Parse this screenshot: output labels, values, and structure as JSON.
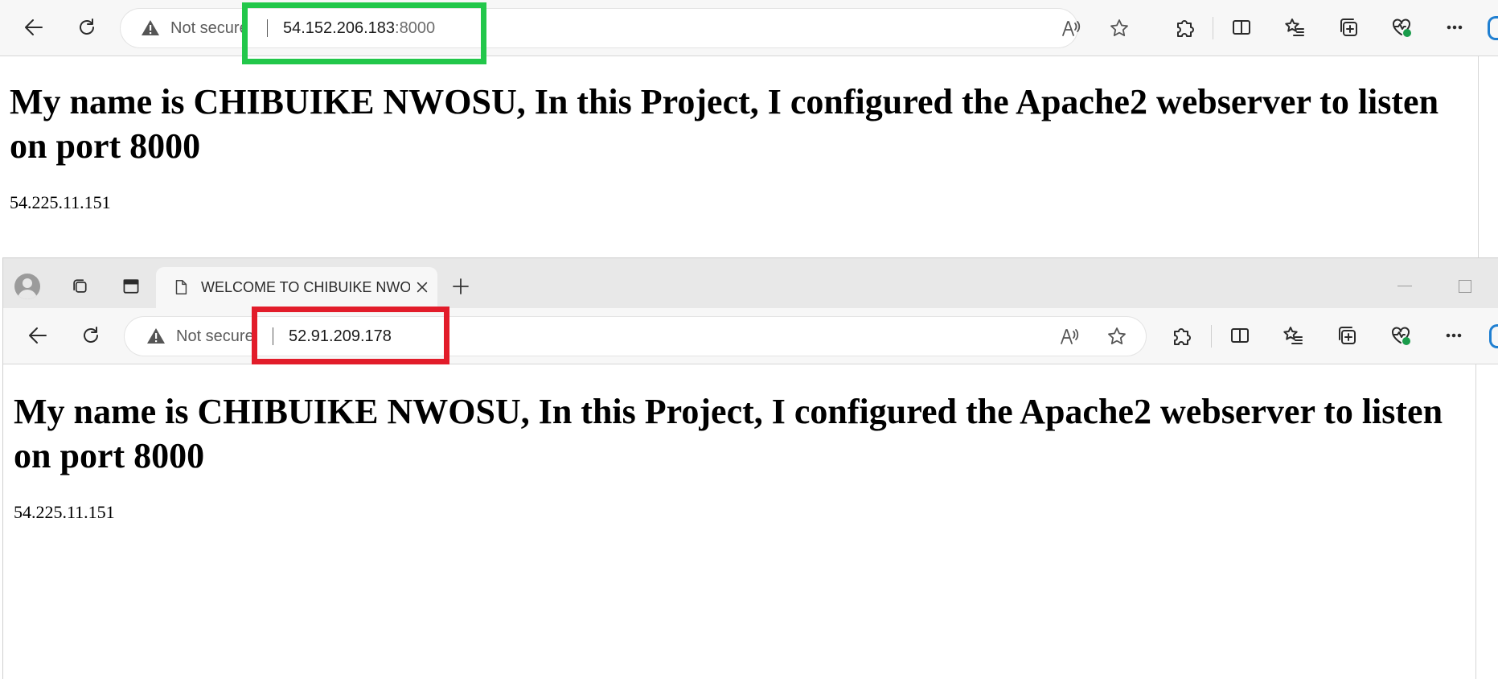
{
  "window_top": {
    "toolbar": {
      "back": "back-arrow",
      "refresh": "refresh",
      "security_label": "Not secure",
      "url_host": "54.152.206.183",
      "url_port": ":8000"
    },
    "page": {
      "heading": "My name is CHIBUIKE NWOSU, In this Project, I configured the Apache2 webserver to listen on port 8000",
      "ip_text": "54.225.11.151"
    },
    "highlight_color": "#22c74a"
  },
  "window_bottom": {
    "tab": {
      "title": "WELCOME TO CHIBUIKE NWOSU"
    },
    "toolbar": {
      "security_label": "Not secure",
      "url_host": "52.91.209.178"
    },
    "page": {
      "heading": "My name is CHIBUIKE NWOSU, In this Project, I configured the Apache2 webserver to listen on port 8000",
      "ip_text": "54.225.11.151"
    },
    "highlight_color": "#e21c2a"
  }
}
